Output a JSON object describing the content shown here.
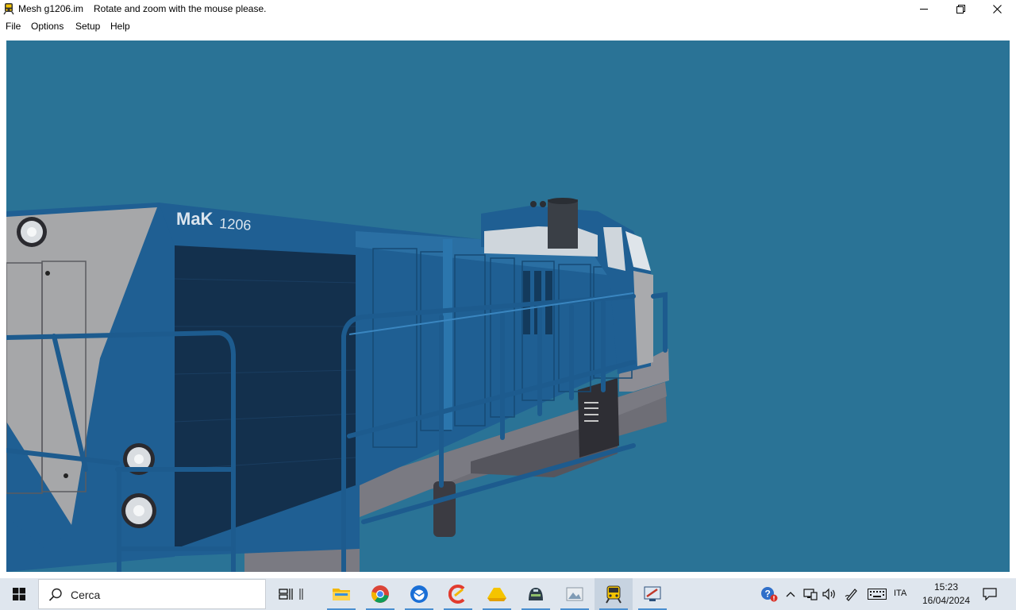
{
  "window": {
    "app_name": "Mesh g1206.im",
    "hint": "Rotate and zoom with the mouse please."
  },
  "menu": {
    "items": [
      "File",
      "Options",
      "Setup",
      "Help"
    ]
  },
  "viewport": {
    "background_color": "#2a7396",
    "locomotive": {
      "brand_text": "MaK",
      "number_text": "1206",
      "body_color": "#1f5f93",
      "nose_color": "#a6a7a9",
      "deck_color": "#6e6e76"
    }
  },
  "taskbar": {
    "search_placeholder": "Cerca",
    "apps": [
      "task-view",
      "file-explorer",
      "chrome",
      "thunderbird",
      "ccleaner",
      "drive",
      "game",
      "photos",
      "train-sim",
      "mesh-viewer"
    ],
    "language": "ITA",
    "time": "15:23",
    "date": "16/04/2024"
  }
}
